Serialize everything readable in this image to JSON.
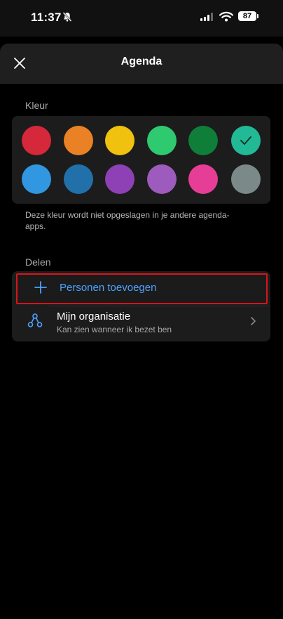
{
  "status_bar": {
    "time": "11:37",
    "battery": "87"
  },
  "header": {
    "title": "Agenda"
  },
  "color_section": {
    "label": "Kleur",
    "swatches": [
      {
        "color": "#d5283a"
      },
      {
        "color": "#ea8124"
      },
      {
        "color": "#f1c10f"
      },
      {
        "color": "#2fc96f"
      },
      {
        "color": "#0e7e39"
      },
      {
        "color": "#22b996",
        "selected": true
      },
      {
        "color": "#3197e0"
      },
      {
        "color": "#2270aa"
      },
      {
        "color": "#8d41b4"
      },
      {
        "color": "#9c5bbd"
      },
      {
        "color": "#e63e97"
      },
      {
        "color": "#7b8a89"
      }
    ],
    "note": "Deze kleur wordt niet opgeslagen in je andere agenda-apps."
  },
  "share_section": {
    "label": "Delen",
    "add_people_label": "Personen toevoegen",
    "org_title": "Mijn organisatie",
    "org_subtitle": "Kan zien wanneer ik bezet ben"
  },
  "colors": {
    "accent": "#4ea1ff",
    "highlight": "#d8151b"
  }
}
